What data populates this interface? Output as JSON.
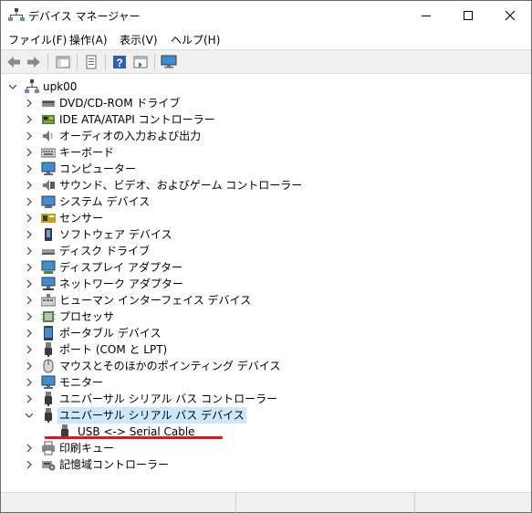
{
  "window": {
    "title": "デバイス マネージャー"
  },
  "menu": {
    "items": [
      "ファイル(F)",
      "操作(A)",
      "表示(V)",
      "ヘルプ(H)"
    ]
  },
  "toolbar": {
    "buttons": [
      "back-icon",
      "forward-icon",
      "properties-icon",
      "show-hide-console-tree-icon",
      "help-icon",
      "action-pane-icon",
      "monitor-icon"
    ]
  },
  "tree": {
    "root": "upk00",
    "categories": [
      "DVD/CD-ROM ドライブ",
      "IDE ATA/ATAPI コントローラー",
      "オーディオの入力および出力",
      "キーボード",
      "コンピューター",
      "サウンド、ビデオ、およびゲーム コントローラー",
      "システム デバイス",
      "センサー",
      "ソフトウェア デバイス",
      "ディスク ドライブ",
      "ディスプレイ アダプター",
      "ネットワーク アダプター",
      "ヒューマン インターフェイス デバイス",
      "プロセッサ",
      "ポータブル デバイス",
      "ポート (COM と LPT)",
      "マウスとそのほかのポインティング デバイス",
      "モニター",
      "ユニバーサル シリアル バス コントローラー",
      "ユニバーサル シリアル バス デバイス"
    ],
    "expanded_child": "USB <-> Serial Cable",
    "after": [
      "印刷キュー",
      "記憶域コントローラー"
    ]
  },
  "colors": {
    "selection": "#cce8ff",
    "highlight_underline": "#e8141d",
    "toolbar_bg": "#f0f0f0"
  }
}
